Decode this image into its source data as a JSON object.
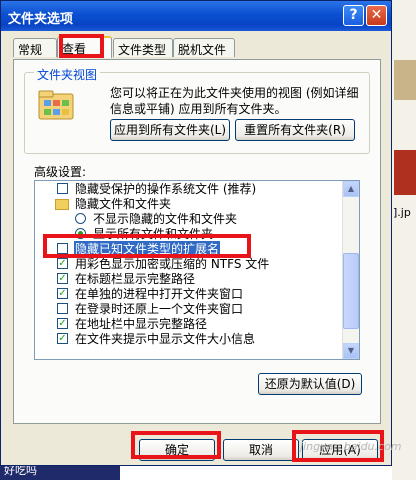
{
  "background": {
    "side_text": "].jp"
  },
  "taskbar": {
    "label": "好吃吗"
  },
  "dialog": {
    "title": "文件夹选项",
    "help_glyph": "?",
    "close_glyph": "✕",
    "tabs": [
      "常规",
      "查看",
      "文件类型",
      "脱机文件"
    ],
    "active_tab": "查看",
    "folder_views": {
      "label": "文件夹视图",
      "description": "您可以将正在为此文件夹使用的视图 (例如详细信息或平铺) 应用到所有文件夹。",
      "apply_all": "应用到所有文件夹(L)",
      "reset_all": "重置所有文件夹(R)"
    },
    "advanced_label": "高级设置:",
    "settings": [
      {
        "kind": "checkbox",
        "label": "隐藏受保护的操作系统文件 (推荐)",
        "checked": false
      },
      {
        "kind": "folder",
        "label": "隐藏文件和文件夹"
      },
      {
        "kind": "radio",
        "label": "不显示隐藏的文件和文件夹",
        "checked": false
      },
      {
        "kind": "radio",
        "label": "显示所有文件和文件夹",
        "checked": true
      },
      {
        "kind": "checkbox",
        "label": "隐藏已知文件类型的扩展名",
        "checked": false,
        "selected": true
      },
      {
        "kind": "checkbox",
        "label": "用彩色显示加密或压缩的 NTFS 文件",
        "checked": true
      },
      {
        "kind": "checkbox",
        "label": "在标题栏显示完整路径",
        "checked": true
      },
      {
        "kind": "checkbox",
        "label": "在单独的进程中打开文件夹窗口",
        "checked": true
      },
      {
        "kind": "checkbox",
        "label": "在登录时还原上一个文件夹窗口",
        "checked": false
      },
      {
        "kind": "checkbox",
        "label": "在地址栏中显示完整路径",
        "checked": true
      },
      {
        "kind": "checkbox",
        "label": "在文件夹提示中显示文件大小信息",
        "checked": true
      }
    ],
    "restore_defaults": "还原为默认值(D)",
    "ok": "确定",
    "cancel": "取消",
    "apply": "应用(A)"
  },
  "watermark": "jingyan.baidu.com",
  "colors": {
    "title_bar": "#0a4fd0",
    "highlight": "#316ac5",
    "annotation_red": "#e8141a",
    "dialog_bg": "#ece9d8"
  }
}
